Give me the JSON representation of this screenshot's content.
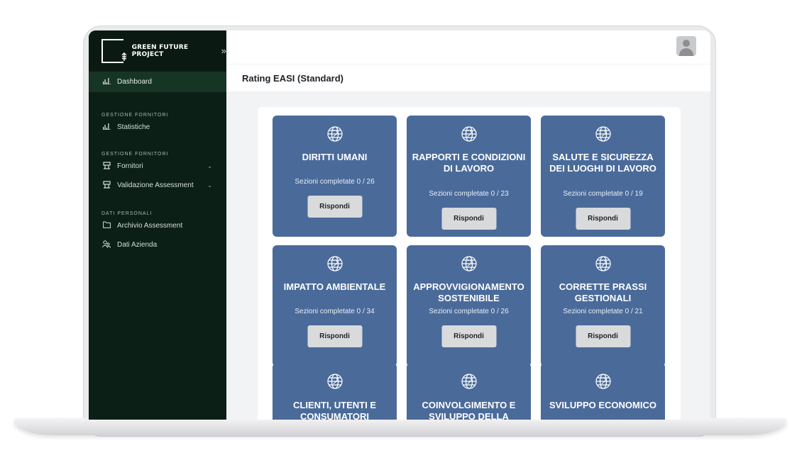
{
  "brand": {
    "name": "GREEN FUTURE PROJECT",
    "toggle": "»"
  },
  "sidebar": {
    "active": {
      "icon": "bar-chart-icon",
      "label": "Dashboard"
    },
    "sections": [
      {
        "heading": "GESTIONE FORNITORI",
        "items": [
          {
            "icon": "bar-chart-icon",
            "label": "Statistiche"
          }
        ]
      },
      {
        "heading": "GESTIONE FORNITORI",
        "items": [
          {
            "icon": "supplier-icon",
            "label": "Fornitori",
            "caret": "⌄"
          },
          {
            "icon": "supplier-icon",
            "label": "Validazione Assessment",
            "caret": "⌄"
          }
        ]
      },
      {
        "heading": "DATI PERSONALI",
        "items": [
          {
            "icon": "folder-icon",
            "label": "Archivio Assessment"
          },
          {
            "icon": "users-icon",
            "label": "Dati Azienda"
          }
        ]
      }
    ]
  },
  "header": {
    "avatar": "avatar-icon"
  },
  "page": {
    "title": "Rating EASI (Standard)"
  },
  "cards": [
    {
      "title": "DIRITTI UMANI",
      "count": "Sezioni completate 0 / 26",
      "button": "Rispondi"
    },
    {
      "title": "RAPPORTI E CONDIZIONI DI LAVORO",
      "count": "Sezioni completate 0 / 23",
      "button": "Rispondi"
    },
    {
      "title": "SALUTE E SICUREZZA DEI LUOGHI DI LAVORO",
      "count": "Sezioni completate 0 / 19",
      "button": "Rispondi"
    },
    {
      "title": "IMPATTO AMBIENTALE",
      "count": "Sezioni completate 0 / 34",
      "button": "Rispondi"
    },
    {
      "title": "APPROVVIGIONAMENTO SOSTENIBILE",
      "count": "Sezioni completate 0 / 26",
      "button": "Rispondi"
    },
    {
      "title": "CORRETTE PRASSI GESTIONALI",
      "count": "Sezioni completate 0 / 21",
      "button": "Rispondi"
    },
    {
      "title": "CLIENTI, UTENTI E CONSUMATORI",
      "count": "",
      "button": ""
    },
    {
      "title": "COINVOLGIMENTO E SVILUPPO DELLA",
      "count": "",
      "button": ""
    },
    {
      "title": "SVILUPPO ECONOMICO",
      "count": "",
      "button": ""
    }
  ],
  "colors": {
    "sidebar": "#0c1f16",
    "sidebar_active": "#173524",
    "card": "#4a6b9a",
    "button": "#d9dadc"
  }
}
